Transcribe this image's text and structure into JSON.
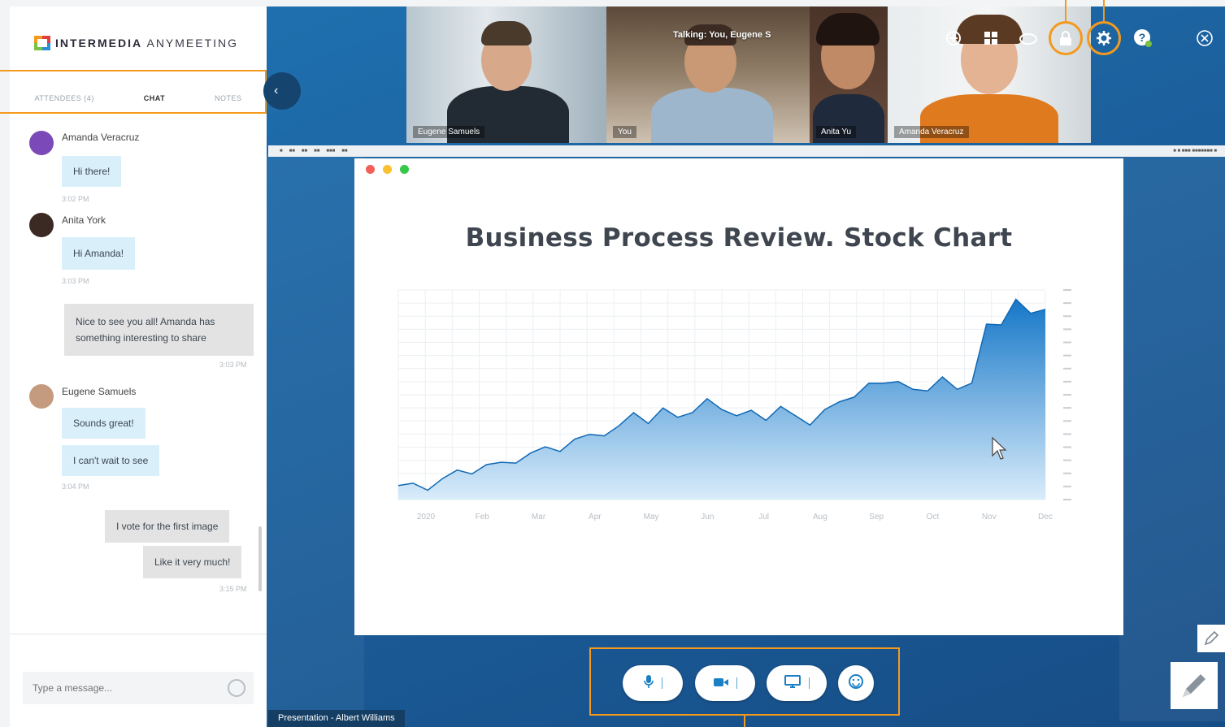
{
  "brand": {
    "name_bold": "INTERMEDIA",
    "name_light": "ANYMEETING"
  },
  "tabs": [
    {
      "label": "ATTENDEES (4)"
    },
    {
      "label": "CHAT"
    },
    {
      "label": "NOTES"
    }
  ],
  "chat": {
    "messages": [
      {
        "name": "Amanda Veracruz",
        "text": "Hi there!",
        "time": "3:02 PM"
      },
      {
        "name": "Anita York",
        "text": "Hi Amanda!",
        "time": "3:03 PM"
      },
      {
        "text": "Nice to see you all! Amanda has something interesting to share",
        "time": "3:03 PM"
      },
      {
        "name": "Eugene Samuels",
        "text1": "Sounds great!",
        "text2": "I can't wait to see",
        "time": "3:04 PM"
      },
      {
        "text1": "I vote for the first image",
        "text2": "Like it very much!",
        "time": "3:15 PM"
      }
    ],
    "input_placeholder": "Type a message..."
  },
  "video": {
    "talking": "Talking: You, Eugene S",
    "tiles": [
      {
        "name": "Eugene Samuels"
      },
      {
        "name": "You"
      },
      {
        "name": "Anita Yu"
      },
      {
        "name": "Amanda Veracruz"
      }
    ]
  },
  "presentation": {
    "title": "Business Process Review. Stock Chart",
    "presenter": "Presentation - Albert Williams"
  },
  "icons": {
    "top": [
      "plus-circle-icon",
      "grid-icon",
      "cloud-icon",
      "lock-icon",
      "gear-icon",
      "help-icon",
      "close-icon"
    ],
    "controls": [
      "microphone-icon",
      "camera-icon",
      "screen-share-icon",
      "emoji-icon"
    ]
  },
  "colors": {
    "accent": "#f39a1e",
    "stage": "#1f6fae",
    "chat_bubble_other": "#d9f0fb",
    "chat_bubble_self": "#e3e3e3",
    "control_icon": "#1a7fc4"
  },
  "chart_data": {
    "type": "area",
    "title": "Business Process Review. Stock Chart",
    "categories": [
      "2020",
      "Feb",
      "Mar",
      "Apr",
      "May",
      "Jun",
      "Jul",
      "Aug",
      "Sep",
      "Oct",
      "Nov",
      "Dec"
    ],
    "y_tick_count": 16,
    "grid": true,
    "series": [
      {
        "values": [
          18,
          21,
          12,
          27,
          38,
          33,
          45,
          48,
          47,
          60,
          68,
          62,
          78,
          84,
          82,
          95,
          112,
          98,
          118,
          106,
          112,
          130,
          116,
          108,
          115,
          102,
          120,
          108,
          96,
          116,
          126,
          132,
          150,
          150,
          152,
          142,
          140,
          158,
          142,
          150,
          226,
          225,
          258,
          240,
          245
        ]
      }
    ]
  }
}
